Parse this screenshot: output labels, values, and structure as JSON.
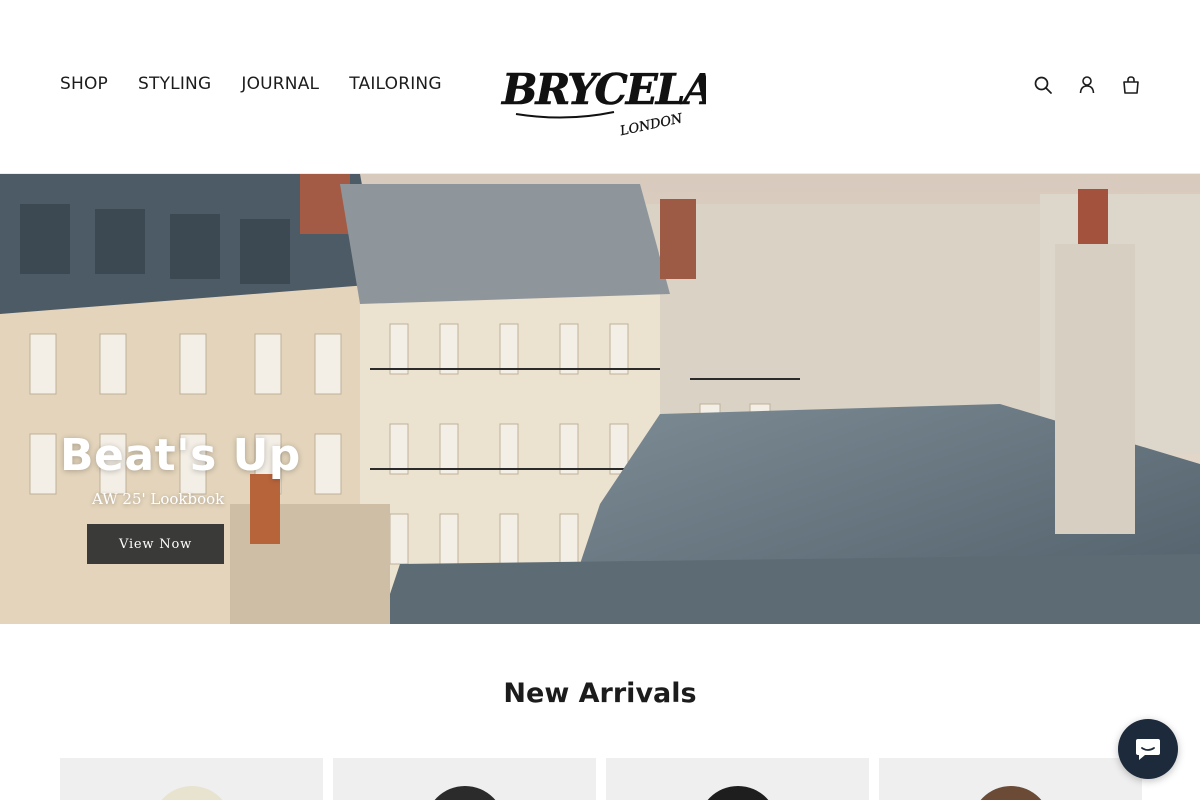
{
  "header": {
    "nav": [
      "SHOP",
      "STYLING",
      "JOURNAL",
      "TAILORING"
    ],
    "logo_text": "BRYCELAND'S",
    "logo_sub": "LONDON",
    "icons": [
      "search-icon",
      "account-icon",
      "cart-icon"
    ]
  },
  "hero": {
    "title": "Beat's Up",
    "subtitle": "AW 25' Lookbook",
    "button_label": "View Now"
  },
  "new_arrivals": {
    "title": "New Arrivals",
    "product_colors": [
      "#e7e3cf",
      "#2b2b2b",
      "#1e1e1e",
      "#6b4a36"
    ]
  },
  "chat": {
    "icon": "chat-icon",
    "color": "#1d2a3c"
  }
}
